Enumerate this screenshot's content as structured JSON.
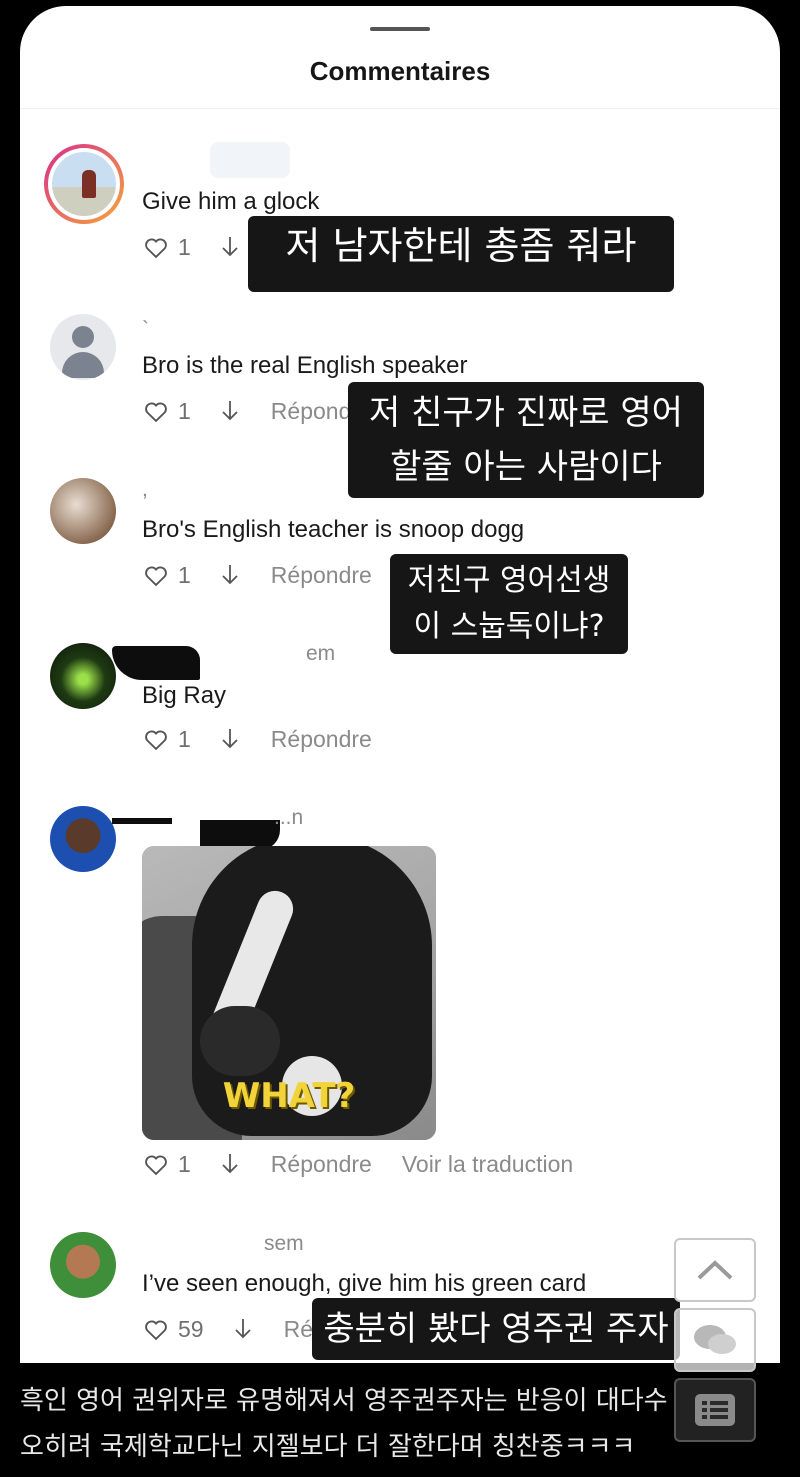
{
  "sheet": {
    "title": "Commentaires"
  },
  "comments": [
    {
      "username": "",
      "text": "Give him a glock",
      "likes": "1",
      "reply": "",
      "caption": "저 남자한테 총좀 줘라"
    },
    {
      "username": "`",
      "text": "Bro is the real English speaker",
      "likes": "1",
      "reply": "Répondre",
      "caption": "저 친구가 진짜로 영어할줄 아는 사람이다"
    },
    {
      "username": ",",
      "text": "Bro's English teacher is snoop dogg",
      "likes": "1",
      "reply": "Répondre",
      "caption": "저친구 영어선생이 스눕독이냐?"
    },
    {
      "username": "em",
      "text": "Big Ray",
      "likes": "1",
      "reply": "Répondre"
    },
    {
      "username": "...n",
      "media_label": "WHAT?",
      "likes": "1",
      "reply": "Répondre",
      "translate": "Voir la traduction"
    },
    {
      "username": "sem",
      "text": "I’ve seen enough, give him his green card",
      "likes": "59",
      "reply": "Ré",
      "caption": "충분히 봤다 영주권 주자"
    }
  ],
  "bottom_text": {
    "line1": "흑인 영어 권위자로 유명해져서 영주권주자는 반응이 대다수",
    "line2": "오히려 국제학교다닌 지젤보다 더 잘한다며 칭찬중ㅋㅋㅋ"
  },
  "icons": [
    "heart-icon",
    "arrow-down-icon",
    "chevron-up-icon",
    "chat-bubbles-icon",
    "list-icon"
  ]
}
